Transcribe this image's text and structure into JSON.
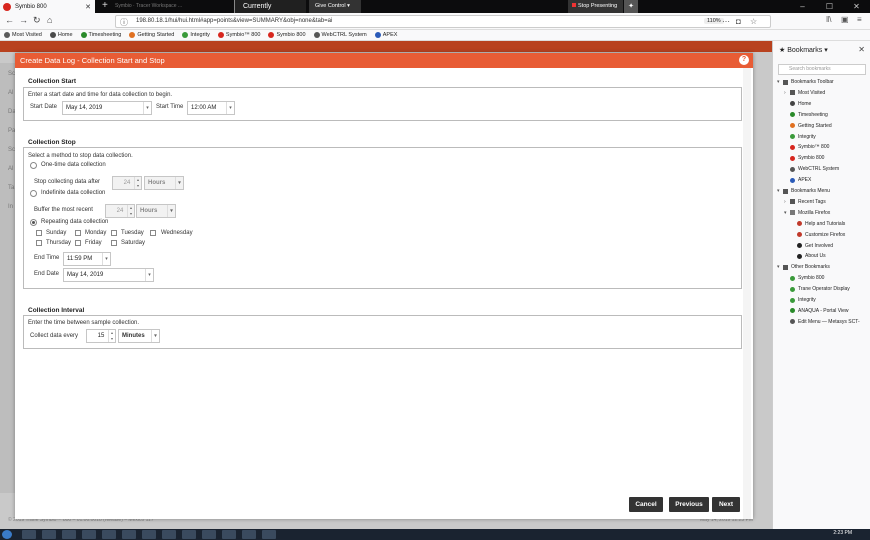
{
  "browser": {
    "tab_title": "Symbio 800",
    "tab2_title": "Symbio · Tracer Workspace ...",
    "new_tab": "+",
    "presenting": "Currently presenting",
    "give_control": "Give Control",
    "stop_presenting": "Stop Presenting",
    "url": "198.80.18.1/hui/hui.html#app=points&view=SUMMARY&obj=none&tab=ai",
    "zoom": "110%",
    "bookmarks": [
      {
        "label": "Most Visited",
        "color": "#5a5a5a"
      },
      {
        "label": "Home",
        "color": "#4b4b4b"
      },
      {
        "label": "Timesheeting",
        "color": "#2a8a2a"
      },
      {
        "label": "Getting Started",
        "color": "#e07020"
      },
      {
        "label": "Integrity",
        "color": "#3a9a3a"
      },
      {
        "label": "Symbio™ 800",
        "color": "#d7261e"
      },
      {
        "label": "Symbio 800",
        "color": "#d7261e"
      },
      {
        "label": "WebCTRL System",
        "color": "#555555"
      },
      {
        "label": "APEX",
        "color": "#2a5ab8"
      }
    ]
  },
  "app": {
    "footer_left": "© 2019 Trane Symbio™ 800 – 01.00.0018 (release) – Mexico 117",
    "footer_right": "May 14, 2019 12:23 PM",
    "left_letters": [
      "Sc",
      "Al",
      "Da",
      "Pa",
      "Sc",
      "Al",
      "Ta",
      "In"
    ],
    "app_label": "App"
  },
  "modal": {
    "title": "Create Data Log - Collection Start and Stop",
    "help": "?",
    "collection_start": {
      "heading": "Collection Start",
      "instruction": "Enter a start date and time for data collection to begin.",
      "start_date_label": "Start Date",
      "start_date_value": "May 14, 2019",
      "start_time_label": "Start Time",
      "start_time_value": "12:00 AM"
    },
    "collection_stop": {
      "heading": "Collection Stop",
      "instruction": "Select a method to stop data collection.",
      "one_time_label": "One-time data collection",
      "stop_after_label": "Stop collecting data after",
      "stop_after_value": "24",
      "stop_after_unit": "Hours",
      "indefinite_label": "Indefinite data collection",
      "buffer_label": "Buffer the most recent",
      "buffer_value": "24",
      "buffer_unit": "Hours",
      "repeating_label": "Repeating data collection",
      "days": [
        "Sunday",
        "Monday",
        "Tuesday",
        "Wednesday",
        "Thursday",
        "Friday",
        "Saturday"
      ],
      "end_time_label": "End Time",
      "end_time_value": "11:59 PM",
      "end_date_label": "End Date",
      "end_date_value": "May 14, 2019"
    },
    "collection_interval": {
      "heading": "Collection Interval",
      "instruction": "Enter the time between sample collection.",
      "collect_label": "Collect data every",
      "collect_value": "15",
      "collect_unit": "Minutes"
    },
    "buttons": {
      "cancel": "Cancel",
      "previous": "Previous",
      "next": "Next"
    }
  },
  "sidebar": {
    "title": "Bookmarks",
    "search_placeholder": "Search bookmarks",
    "items": [
      {
        "label": "Bookmarks Toolbar",
        "indent": 0,
        "twisty": "▾",
        "color": "#555"
      },
      {
        "label": "Most Visited",
        "indent": 1,
        "twisty": "›",
        "color": "#555"
      },
      {
        "label": "Home",
        "indent": 1,
        "twisty": "",
        "color": "#444"
      },
      {
        "label": "Timesheeting",
        "indent": 1,
        "twisty": "",
        "color": "#2a8a2a"
      },
      {
        "label": "Getting Started",
        "indent": 1,
        "twisty": "",
        "color": "#e07020"
      },
      {
        "label": "Integrity",
        "indent": 1,
        "twisty": "",
        "color": "#3a9a3a"
      },
      {
        "label": "Symbio™ 800",
        "indent": 1,
        "twisty": "",
        "color": "#d7261e"
      },
      {
        "label": "Symbio 800",
        "indent": 1,
        "twisty": "",
        "color": "#d7261e"
      },
      {
        "label": "WebCTRL System",
        "indent": 1,
        "twisty": "",
        "color": "#555"
      },
      {
        "label": "APEX",
        "indent": 1,
        "twisty": "",
        "color": "#2a5ab8"
      },
      {
        "label": "Bookmarks Menu",
        "indent": 0,
        "twisty": "▾",
        "color": "#555"
      },
      {
        "label": "Recent Tags",
        "indent": 1,
        "twisty": "›",
        "color": "#555"
      },
      {
        "label": "Mozilla Firefox",
        "indent": 1,
        "twisty": "▾",
        "color": "#777"
      },
      {
        "label": "Help and Tutorials",
        "indent": 2,
        "twisty": "",
        "color": "#c0392b"
      },
      {
        "label": "Customize Firefox",
        "indent": 2,
        "twisty": "",
        "color": "#c0392b"
      },
      {
        "label": "Get Involved",
        "indent": 2,
        "twisty": "",
        "color": "#222"
      },
      {
        "label": "About Us",
        "indent": 2,
        "twisty": "",
        "color": "#222"
      },
      {
        "label": "Other Bookmarks",
        "indent": 0,
        "twisty": "▾",
        "color": "#555"
      },
      {
        "label": "Symbio 800",
        "indent": 1,
        "twisty": "",
        "color": "#3a9a3a"
      },
      {
        "label": "Trane Operator Display",
        "indent": 1,
        "twisty": "",
        "color": "#3a9a3a"
      },
      {
        "label": "Integrity",
        "indent": 1,
        "twisty": "",
        "color": "#3a9a3a"
      },
      {
        "label": "ANAQUA - Portal View",
        "indent": 1,
        "twisty": "",
        "color": "#2a8a2a"
      },
      {
        "label": "Edit Menu — Metasys SCT-",
        "indent": 1,
        "twisty": "",
        "color": "#555"
      }
    ]
  },
  "taskbar": {
    "clock": "2:23 PM"
  }
}
